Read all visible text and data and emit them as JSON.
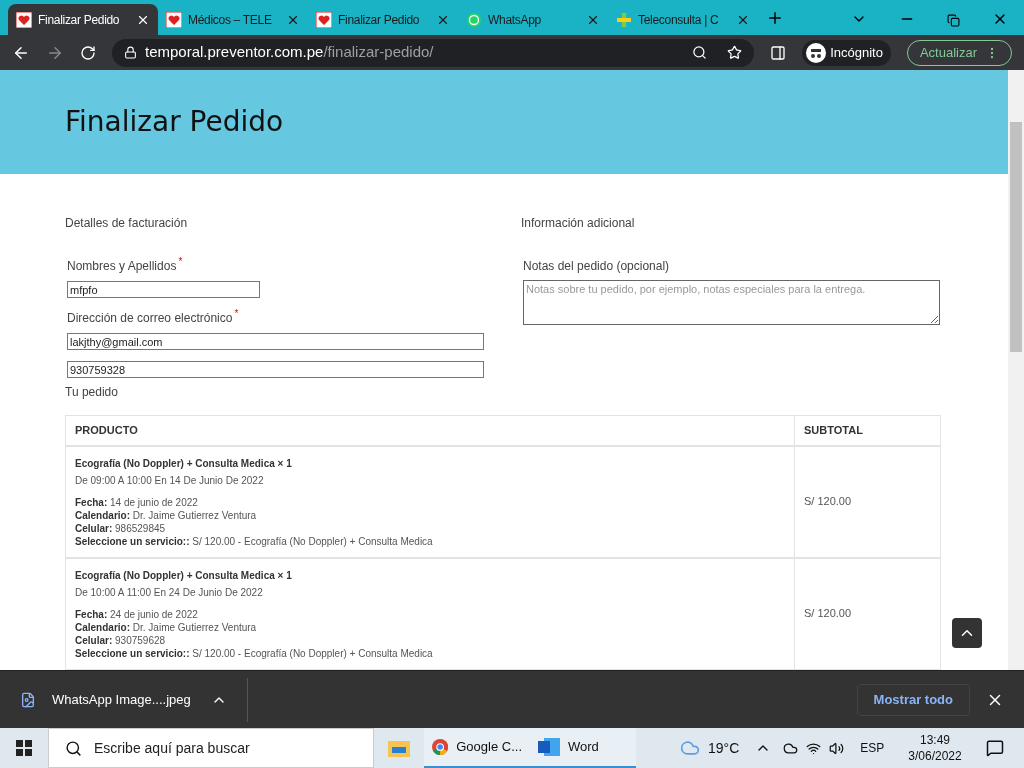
{
  "browser": {
    "tabs": [
      {
        "title": "Finalizar Pedido",
        "selected": true,
        "kind": "heart"
      },
      {
        "title": "Médicos – TELE",
        "selected": false,
        "kind": "heart"
      },
      {
        "title": "Finalizar Pedido",
        "selected": false,
        "kind": "heart"
      },
      {
        "title": "WhatsApp",
        "selected": false,
        "kind": "chat"
      },
      {
        "title": "Teleconsulta | C",
        "selected": false,
        "kind": "cross"
      }
    ],
    "url_host": "temporal.preventor.com.pe",
    "url_path": "/finalizar-pedido/",
    "profile": "Incógnito",
    "update_button": "Actualizar"
  },
  "page": {
    "title": "Finalizar Pedido",
    "billing": {
      "heading": "Detalles de facturación",
      "fields": [
        {
          "label": "Nombres y Apellidos",
          "required_mark": "*",
          "value": "mfpfo"
        },
        {
          "label": "Dirección de correo electrónico",
          "required_mark": "*",
          "value": "lakjthy@gmail.com"
        },
        {
          "value": "930759328"
        }
      ]
    },
    "additional": {
      "heading": "Información adicional",
      "notes_label": "Notas del pedido (opcional)",
      "notes_placeholder": "Notas sobre tu pedido, por ejemplo, notas especiales para la entrega."
    },
    "order": {
      "heading": "Tu pedido",
      "columns": [
        "PRODUCTO",
        "SUBTOTAL"
      ],
      "rows": [
        {
          "product": "Ecografía (No Doppler) + Consulta Medica × 1",
          "time": "De 09:00 A 10:00 En 14 De Junio De 2022",
          "details": [
            "**Fecha:** 14 de junio de 2022",
            "**Calendario:** Dr. Jaime Gutierrez Ventura",
            "**Celular:** 986529845",
            "**Seleccione un servicio::** S/ 120.00 - Ecografía (No Doppler) + Consulta Medica"
          ],
          "subtotal": "S/ 120.00"
        },
        {
          "product": "Ecografía (No Doppler) + Consulta Medica × 1",
          "time": "De 10:00 A 11:00 En 24 De Junio De 2022",
          "details": [
            "**Fecha:** 24 de junio de 2022",
            "**Calendario:** Dr. Jaime Gutierrez Ventura",
            "**Celular:** 930759628",
            "**Seleccione un servicio::** S/ 120.00 - Ecografía (No Doppler) + Consulta Medica"
          ],
          "subtotal": "S/ 120.00"
        }
      ]
    }
  },
  "download_bar": {
    "file": "WhatsApp Image....jpeg",
    "show_all": "Mostrar todo"
  },
  "taskbar": {
    "search_placeholder": "Escribe aquí para buscar",
    "apps": [
      {
        "label": "Google C...",
        "kind": "chrome",
        "running": true
      },
      {
        "label": "Word",
        "kind": "word",
        "running": true
      }
    ],
    "weather": "19°C",
    "language": "ESP",
    "time": "13:49",
    "date": "3/06/2022"
  }
}
